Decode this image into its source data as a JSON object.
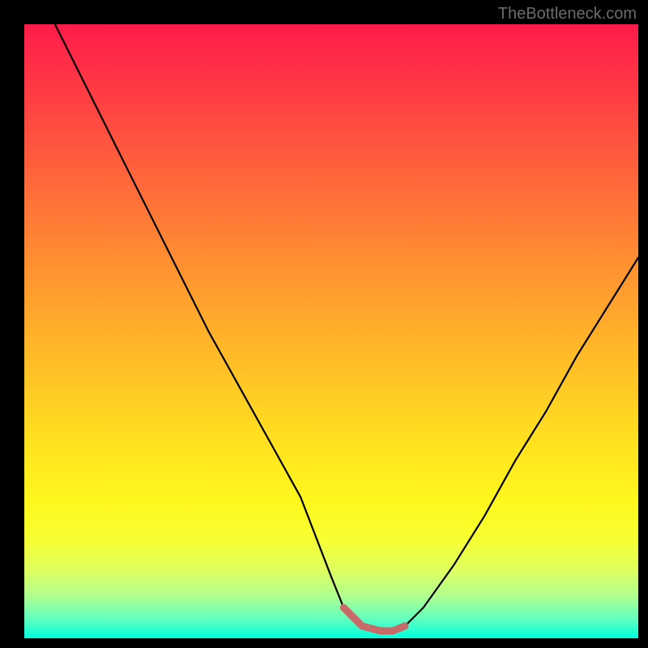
{
  "watermark_text": "TheBottleneck.com",
  "chart_data": {
    "type": "line",
    "title": "",
    "xlabel": "",
    "ylabel": "",
    "xlim": [
      0,
      100
    ],
    "ylim": [
      0,
      100
    ],
    "x": [
      5,
      10,
      15,
      20,
      25,
      30,
      35,
      40,
      45,
      50,
      52,
      55,
      58,
      60,
      62,
      65,
      70,
      75,
      80,
      85,
      90,
      95,
      100
    ],
    "y": [
      100,
      90,
      80,
      70,
      60,
      50,
      41,
      32,
      23,
      10,
      5,
      2,
      1,
      1,
      2,
      5,
      12,
      20,
      29,
      37,
      46,
      54,
      62
    ],
    "series": [
      {
        "name": "bottleneck-curve",
        "color": "#000000",
        "stroke_width": 2
      }
    ],
    "flat_marker": {
      "color": "#c96a6a",
      "x_range": [
        52,
        62
      ],
      "y": 1.2,
      "stroke_width": 8
    },
    "background_gradient": {
      "top": "#ff1b4b",
      "mid": "#ffd123",
      "bottom": "#00ffde"
    }
  }
}
